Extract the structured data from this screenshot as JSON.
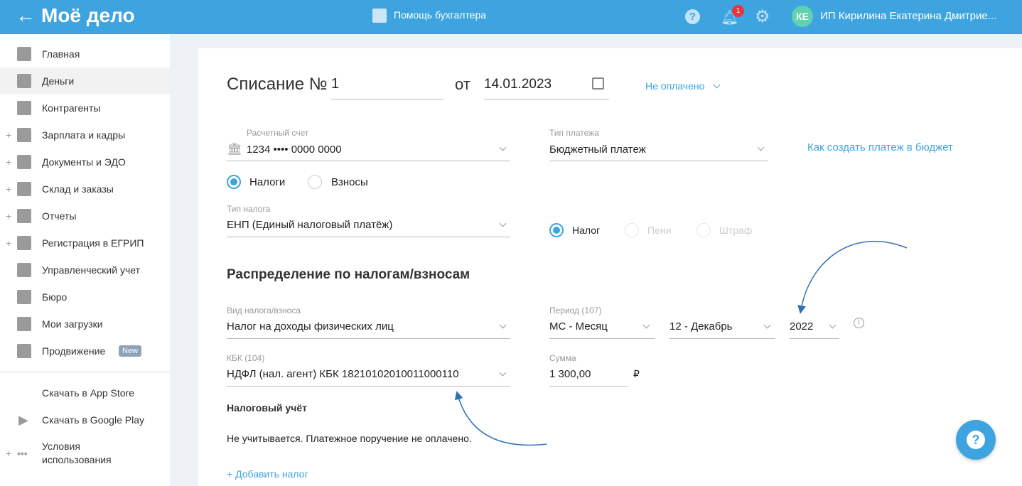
{
  "header": {
    "logo": "Моё дело",
    "help_label": "Помощь бухгалтера",
    "notif_count": "1",
    "avatar": "КЕ",
    "user": "ИП Кирилина Екатерина Дмитрие..."
  },
  "sidebar": {
    "items": [
      {
        "label": "Главная",
        "plus": false
      },
      {
        "label": "Деньги",
        "plus": false,
        "active": true
      },
      {
        "label": "Контрагенты",
        "plus": false
      },
      {
        "label": "Зарплата и кадры",
        "plus": true
      },
      {
        "label": "Документы и ЭДО",
        "plus": true
      },
      {
        "label": "Склад и заказы",
        "plus": true
      },
      {
        "label": "Отчеты",
        "plus": true
      },
      {
        "label": "Регистрация в ЕГРИП",
        "plus": true
      },
      {
        "label": "Управленческий учет",
        "plus": false
      },
      {
        "label": "Бюро",
        "plus": false
      },
      {
        "label": "Мои загрузки",
        "plus": false
      },
      {
        "label": "Продвижение",
        "plus": false
      }
    ],
    "new_badge": "New",
    "app_store": "Скачать в App Store",
    "google_play": "Скачать в Google Play",
    "terms_1": "Условия",
    "terms_2": "использования"
  },
  "form": {
    "title": "Списание №",
    "number": "1",
    "from": "от",
    "date": "14.01.2023",
    "status": "Не оплачено",
    "account_label": "Расчетный счет",
    "account": "1234 •••• 0000 0000",
    "payment_type_label": "Тип платежа",
    "payment_type": "Бюджетный платеж",
    "budget_link": "Как создать платеж в бюджет",
    "radio_taxes": "Налоги",
    "radio_contrib": "Взносы",
    "tax_type_label": "Тип налога",
    "tax_type": "ЕНП (Единый налоговый платёж)",
    "radio_tax": "Налог",
    "radio_penalty": "Пени",
    "radio_fine": "Штраф",
    "section_title": "Распределение по налогам/взносам",
    "kind_label": "Вид налога/взноса",
    "kind": "Налог на доходы физических лиц",
    "period_label": "Период (107)",
    "period_type": "МС - Месяц",
    "period_month": "12 - Декабрь",
    "period_year": "2022",
    "kbk_label": "КБК (104)",
    "kbk": "НДФЛ (нал. агент) КБК 18210102010011000110",
    "sum_label": "Сумма",
    "sum": "1 300,00",
    "currency": "₽",
    "accounting_title": "Налоговый учёт",
    "accounting_text": "Не учитывается. Платежное поручение не оплачено.",
    "add_tax": "+ Добавить налог"
  }
}
